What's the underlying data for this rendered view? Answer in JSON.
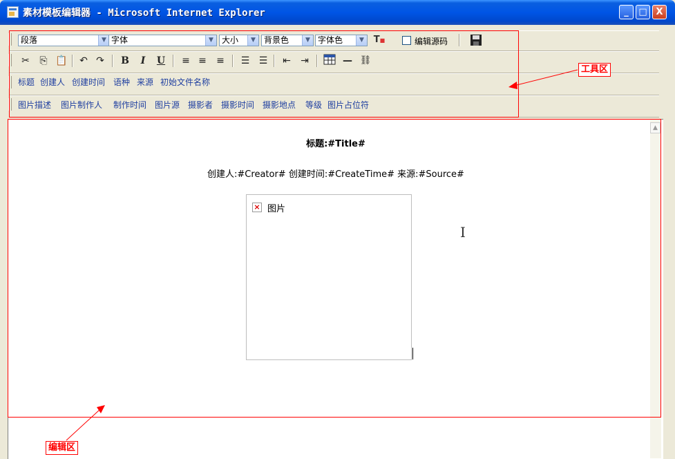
{
  "window": {
    "title": "素材模板编辑器 - Microsoft Internet Explorer",
    "controls": [
      "_",
      "□",
      "X"
    ]
  },
  "toolbar": {
    "paragraph_select": "段落",
    "font_select": "字体",
    "size_select": "大小",
    "bgcolor_select": "背景色",
    "fontcolor_select": "字体色",
    "edit_source_label": "编辑源码",
    "edit_source_checked": false,
    "format_buttons": [
      "cut-icon",
      "copy-icon",
      "paste-icon",
      "undo-icon",
      "redo-icon",
      "bold-icon",
      "italic-icon",
      "underline-icon",
      "align-left-icon",
      "align-center-icon",
      "align-right-icon",
      "numbered-list-icon",
      "bullet-list-icon",
      "outdent-icon",
      "indent-icon",
      "table-icon",
      "horizontal-rule-icon",
      "link-icon"
    ],
    "text_fields": [
      "标题",
      "创建人",
      "创建时间",
      "语种",
      "来源",
      "初始文件名称"
    ],
    "image_fields": [
      "图片描述",
      "图片制作人",
      "制作时间",
      "图片源",
      "摄影者",
      "摄影时间",
      "摄影地点",
      "等级",
      "图片占位符"
    ]
  },
  "annotations": {
    "toolbar_label": "工具区",
    "editor_label": "编辑区",
    "color": "#ff0000"
  },
  "editor": {
    "title_line": "标题:#Title#",
    "meta_line": "创建人:#Creator# 创建时间:#CreateTime# 来源:#Source#",
    "image_alt": "图片"
  }
}
